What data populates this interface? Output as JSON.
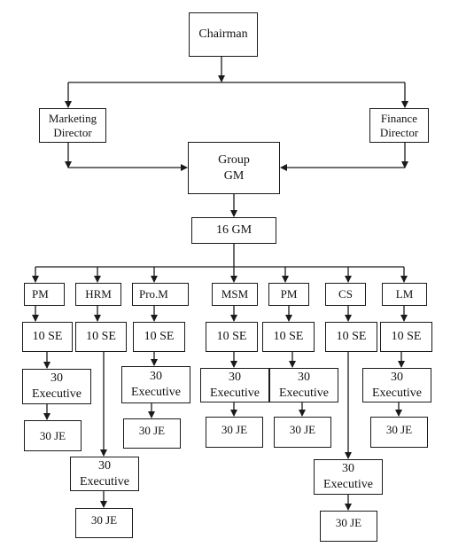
{
  "diagram": {
    "type": "org-chart",
    "nodes": [
      {
        "id": "chairman",
        "label": "Chairman"
      },
      {
        "id": "marketing-director",
        "label": "Marketing\nDirector"
      },
      {
        "id": "finance-director",
        "label": "Finance\nDirector"
      },
      {
        "id": "group-gm",
        "label": "Group\nGM"
      },
      {
        "id": "gm-16",
        "label": "16 GM"
      },
      {
        "id": "pm-1",
        "label": "PM"
      },
      {
        "id": "hrm",
        "label": "HRM"
      },
      {
        "id": "pro-m",
        "label": "Pro.M"
      },
      {
        "id": "msm",
        "label": "MSM"
      },
      {
        "id": "pm-2",
        "label": "PM"
      },
      {
        "id": "cs",
        "label": "CS"
      },
      {
        "id": "lm",
        "label": "LM"
      },
      {
        "id": "se-1",
        "label": "10 SE"
      },
      {
        "id": "se-2",
        "label": "10 SE"
      },
      {
        "id": "se-3",
        "label": "10 SE"
      },
      {
        "id": "se-4",
        "label": "10 SE"
      },
      {
        "id": "se-5",
        "label": "10 SE"
      },
      {
        "id": "se-6",
        "label": "10 SE"
      },
      {
        "id": "se-7",
        "label": "10 SE"
      },
      {
        "id": "exec-1",
        "label": "30\nExecutive"
      },
      {
        "id": "exec-2",
        "label": "30\nExecutive"
      },
      {
        "id": "exec-3",
        "label": "30\nExecutive"
      },
      {
        "id": "exec-4",
        "label": "30\nExecutive"
      },
      {
        "id": "exec-5",
        "label": "30\nExecutive"
      },
      {
        "id": "exec-6",
        "label": "30\nExecutive"
      },
      {
        "id": "exec-7",
        "label": "30\nExecutive"
      },
      {
        "id": "je-1",
        "label": "30 JE"
      },
      {
        "id": "je-2",
        "label": "30 JE"
      },
      {
        "id": "je-3",
        "label": "30 JE"
      },
      {
        "id": "je-4",
        "label": "30 JE"
      },
      {
        "id": "je-5",
        "label": "30 JE"
      },
      {
        "id": "je-6",
        "label": "30 JE"
      },
      {
        "id": "je-7",
        "label": "30 JE"
      }
    ],
    "edges": [
      {
        "from": "chairman",
        "to": "marketing-director"
      },
      {
        "from": "chairman",
        "to": "finance-director"
      },
      {
        "from": "marketing-director",
        "to": "group-gm"
      },
      {
        "from": "finance-director",
        "to": "group-gm"
      },
      {
        "from": "group-gm",
        "to": "gm-16"
      },
      {
        "from": "gm-16",
        "to": "pm-1"
      },
      {
        "from": "gm-16",
        "to": "hrm"
      },
      {
        "from": "gm-16",
        "to": "pro-m"
      },
      {
        "from": "gm-16",
        "to": "msm"
      },
      {
        "from": "gm-16",
        "to": "pm-2"
      },
      {
        "from": "gm-16",
        "to": "cs"
      },
      {
        "from": "gm-16",
        "to": "lm"
      },
      {
        "from": "pm-1",
        "to": "se-1"
      },
      {
        "from": "hrm",
        "to": "se-2"
      },
      {
        "from": "pro-m",
        "to": "se-3"
      },
      {
        "from": "msm",
        "to": "se-4"
      },
      {
        "from": "pm-2",
        "to": "se-5"
      },
      {
        "from": "cs",
        "to": "se-6"
      },
      {
        "from": "lm",
        "to": "se-7"
      },
      {
        "from": "se-1",
        "to": "exec-1"
      },
      {
        "from": "se-2",
        "to": "exec-2"
      },
      {
        "from": "se-3",
        "to": "exec-3"
      },
      {
        "from": "se-4",
        "to": "exec-4"
      },
      {
        "from": "se-5",
        "to": "exec-5"
      },
      {
        "from": "se-6",
        "to": "exec-6"
      },
      {
        "from": "se-7",
        "to": "exec-7"
      },
      {
        "from": "exec-1",
        "to": "je-1"
      },
      {
        "from": "exec-2",
        "to": "je-2"
      },
      {
        "from": "exec-3",
        "to": "je-3"
      },
      {
        "from": "exec-4",
        "to": "je-4"
      },
      {
        "from": "exec-5",
        "to": "je-5"
      },
      {
        "from": "exec-6",
        "to": "je-6"
      },
      {
        "from": "exec-7",
        "to": "je-7"
      }
    ]
  }
}
